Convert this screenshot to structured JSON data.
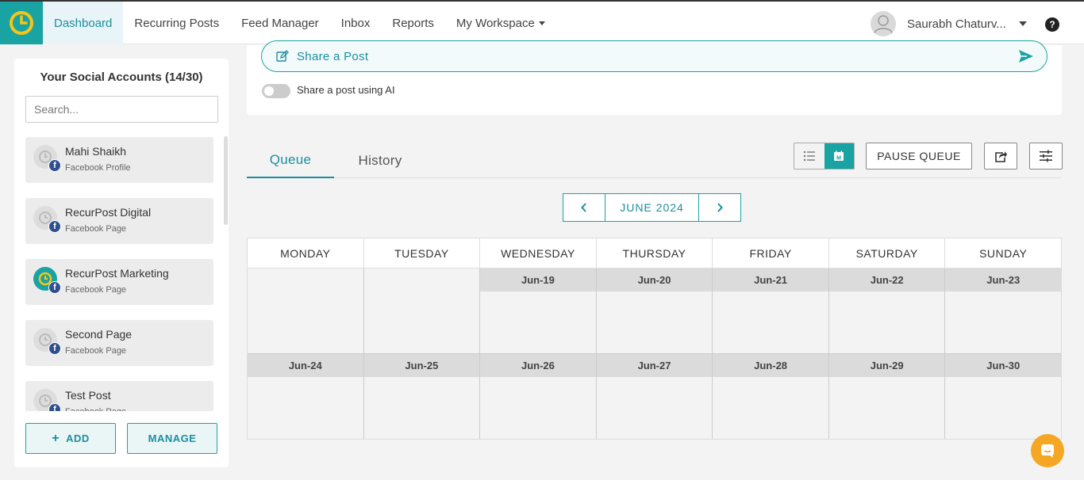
{
  "nav": {
    "items": [
      {
        "label": "Dashboard",
        "active": true
      },
      {
        "label": "Recurring Posts",
        "active": false
      },
      {
        "label": "Feed Manager",
        "active": false
      },
      {
        "label": "Inbox",
        "active": false
      },
      {
        "label": "Reports",
        "active": false
      },
      {
        "label": "My Workspace",
        "active": false
      }
    ],
    "user_name": "Saurabh Chaturv...",
    "help": "?"
  },
  "sidebar": {
    "title": "Your Social Accounts (14/30)",
    "search_placeholder": "Search...",
    "accounts": [
      {
        "name": "Mahi Shaikh",
        "type": "Facebook Profile"
      },
      {
        "name": "RecurPost Digital",
        "type": "Facebook Page"
      },
      {
        "name": "RecurPost Marketing",
        "type": "Facebook Page"
      },
      {
        "name": "Second Page",
        "type": "Facebook Page"
      },
      {
        "name": "Test Post",
        "type": "Facebook Page"
      }
    ],
    "add_label": "ADD",
    "manage_label": "MANAGE"
  },
  "share": {
    "label": "Share a Post",
    "ai_label": "Share a post using AI",
    "ai_enabled": false
  },
  "tabs": [
    {
      "label": "Queue",
      "active": true
    },
    {
      "label": "History",
      "active": false
    }
  ],
  "toolbar": {
    "pause_label": "PAUSE QUEUE",
    "calendar_view_letter": "M",
    "view_mode": "calendar"
  },
  "month_nav": {
    "label": "JUNE 2024"
  },
  "calendar": {
    "days": [
      "MONDAY",
      "TUESDAY",
      "WEDNESDAY",
      "THURSDAY",
      "FRIDAY",
      "SATURDAY",
      "SUNDAY"
    ],
    "weeks": [
      [
        "",
        "",
        "Jun-19",
        "Jun-20",
        "Jun-21",
        "Jun-22",
        "Jun-23"
      ],
      [
        "Jun-24",
        "Jun-25",
        "Jun-26",
        "Jun-27",
        "Jun-28",
        "Jun-29",
        "Jun-30"
      ]
    ]
  },
  "colors": {
    "accent": "#1aa3a3",
    "accent_text": "#1a8fa0",
    "chat": "#f5a623",
    "facebook": "#2f4f8f"
  }
}
